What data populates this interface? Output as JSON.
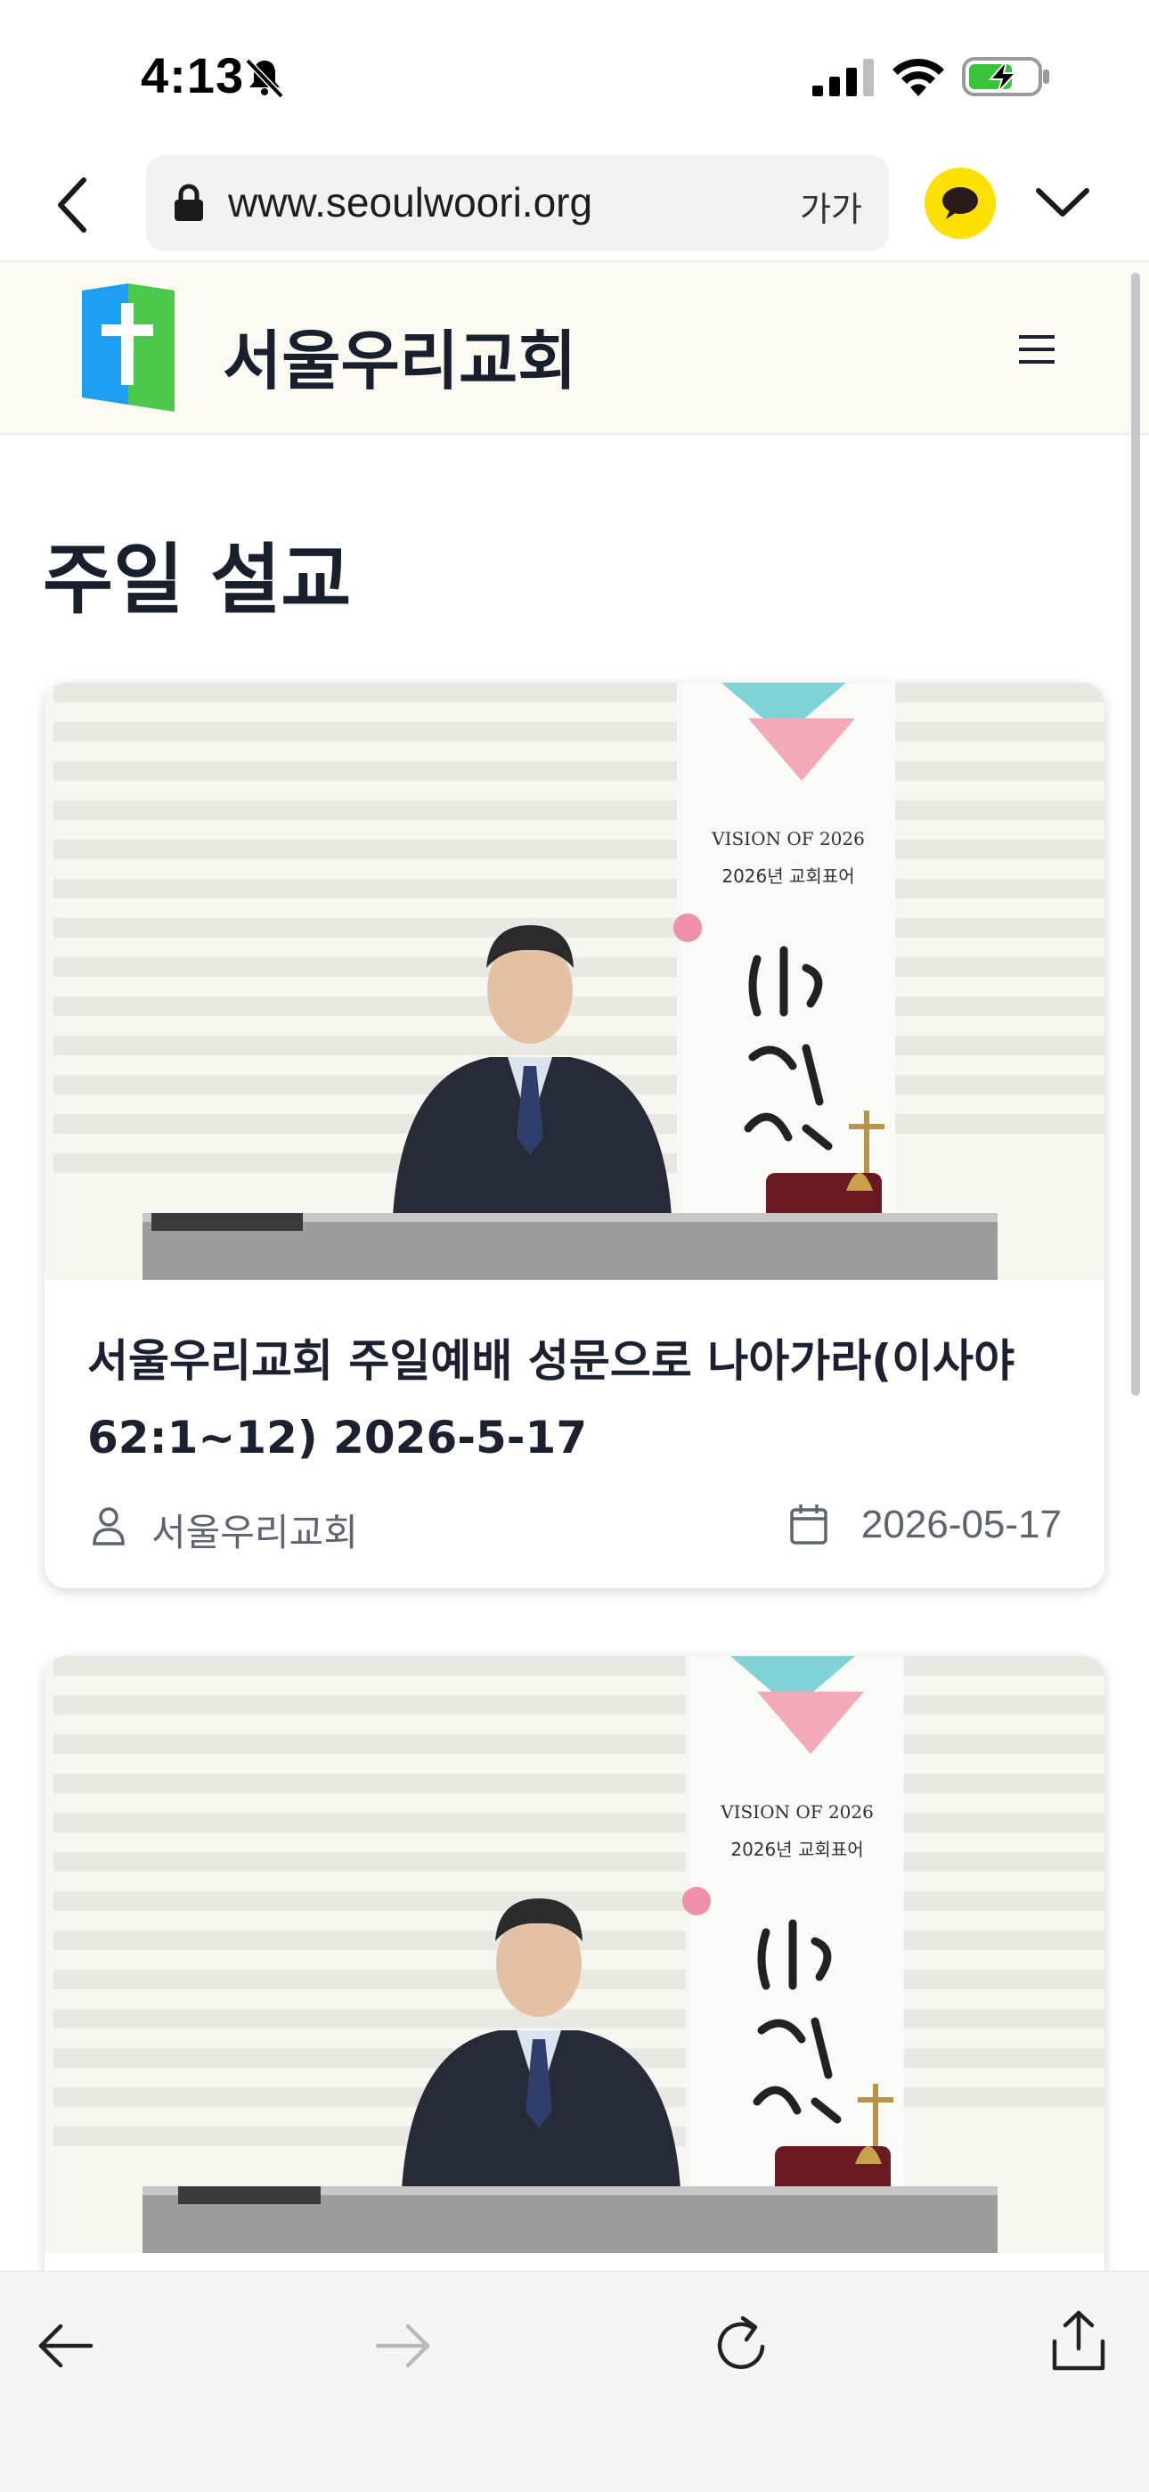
{
  "status_bar": {
    "time": "4:13",
    "icons": [
      "bell-slash-icon",
      "cellular-signal-icon",
      "wifi-icon",
      "battery-charging-icon"
    ]
  },
  "browser": {
    "url": "www.seoulwoori.org",
    "text_size_label": "가가",
    "icons": [
      "back-chevron-icon",
      "lock-icon",
      "kakao-talk-icon",
      "chevron-down-icon"
    ]
  },
  "site": {
    "name": "서울우리교회",
    "logo_colors": {
      "blue": "#1e9ef0",
      "green": "#4cc94c",
      "cross": "#ffffff"
    },
    "menu_icon": "hamburger-menu-icon"
  },
  "page": {
    "title": "주일 설교"
  },
  "posts": [
    {
      "title": "서울우리교회 주일예배 성문으로 나아가라(이사야 62:1~12) 2026-5-17",
      "author": "서울우리교회",
      "date": "2026-05-17",
      "banner_text": {
        "line1": "VISION OF 2026",
        "line2": "2026년 교회표어"
      }
    },
    {
      "title": "",
      "author": "",
      "date": "",
      "banner_text": {
        "line1": "VISION OF 2026",
        "line2": "2026년 교회표어"
      }
    }
  ],
  "toolbar": {
    "icons": [
      "arrow-left-icon",
      "arrow-right-icon",
      "reload-icon",
      "share-icon"
    ]
  },
  "colors": {
    "header_bg": "#fafaf3",
    "text_dark": "#17202c",
    "meta_gray": "#5d6472",
    "kakao_yellow": "#fae100"
  }
}
